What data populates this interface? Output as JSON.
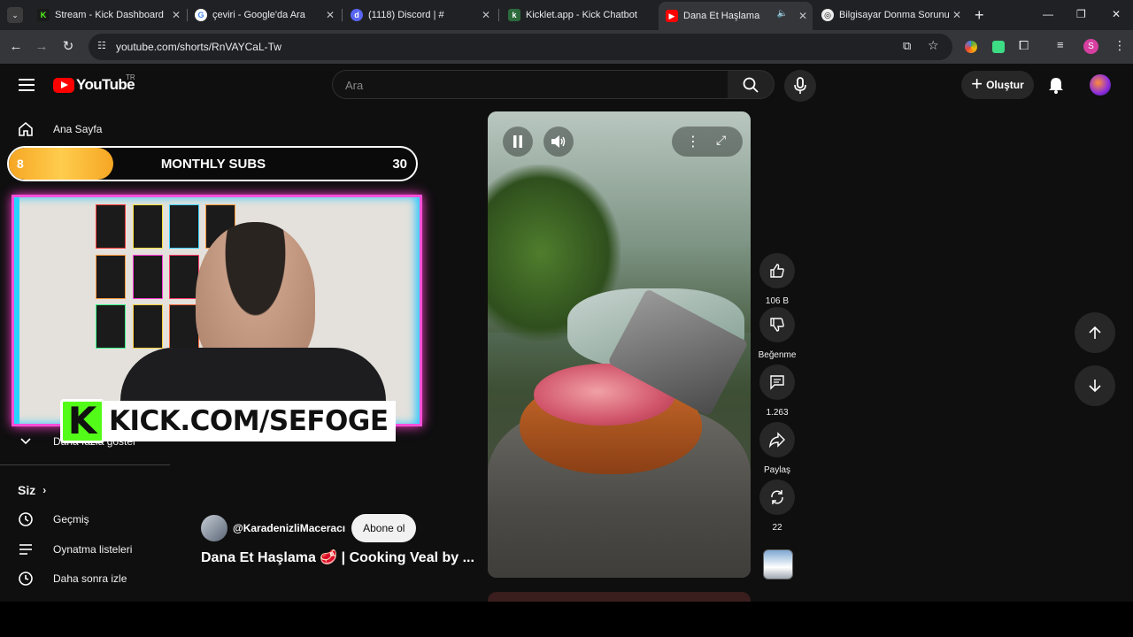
{
  "browser": {
    "tabs": [
      {
        "title": "Stream - Kick Dashboard",
        "icon": "kick-icon"
      },
      {
        "title": "çeviri - Google'da Ara",
        "icon": "google-icon"
      },
      {
        "title": "(1118) Discord | #",
        "icon": "discord-icon"
      },
      {
        "title": "Kicklet.app - Kick Chatbot",
        "icon": "kicklet-icon"
      },
      {
        "title": "Dana Et Haşlama",
        "icon": "youtube-icon"
      },
      {
        "title": "Bilgisayar Donma Sorunu",
        "icon": "chatgpt-icon"
      }
    ],
    "url": "youtube.com/shorts/RnVAYCaL-Tw",
    "profile_initial": "S"
  },
  "youtube": {
    "logo_text": "YouTube",
    "country": "TR",
    "search_placeholder": "Ara",
    "create_label": "Oluştur"
  },
  "sidebar": {
    "home": "Ana Sayfa",
    "show_more": "Daha fazla göster",
    "you": "Siz",
    "history": "Geçmiş",
    "playlists": "Oynatma listeleri",
    "watch_later": "Daha sonra izle"
  },
  "overlay": {
    "subs_current": "8",
    "subs_title": "MONTHLY SUBS",
    "subs_goal": "30",
    "kick_letter": "K",
    "kick_url": "KICK.COM/SEFOGE"
  },
  "short": {
    "channel": "@KaradenizliMaceracı",
    "subscribe": "Abone ol",
    "title": "Dana Et Haşlama 🥩 | Cooking Veal by ...",
    "likes": "106 B",
    "dislike": "Beğenme",
    "comments": "1.263",
    "share": "Paylaş",
    "remix": "22"
  }
}
